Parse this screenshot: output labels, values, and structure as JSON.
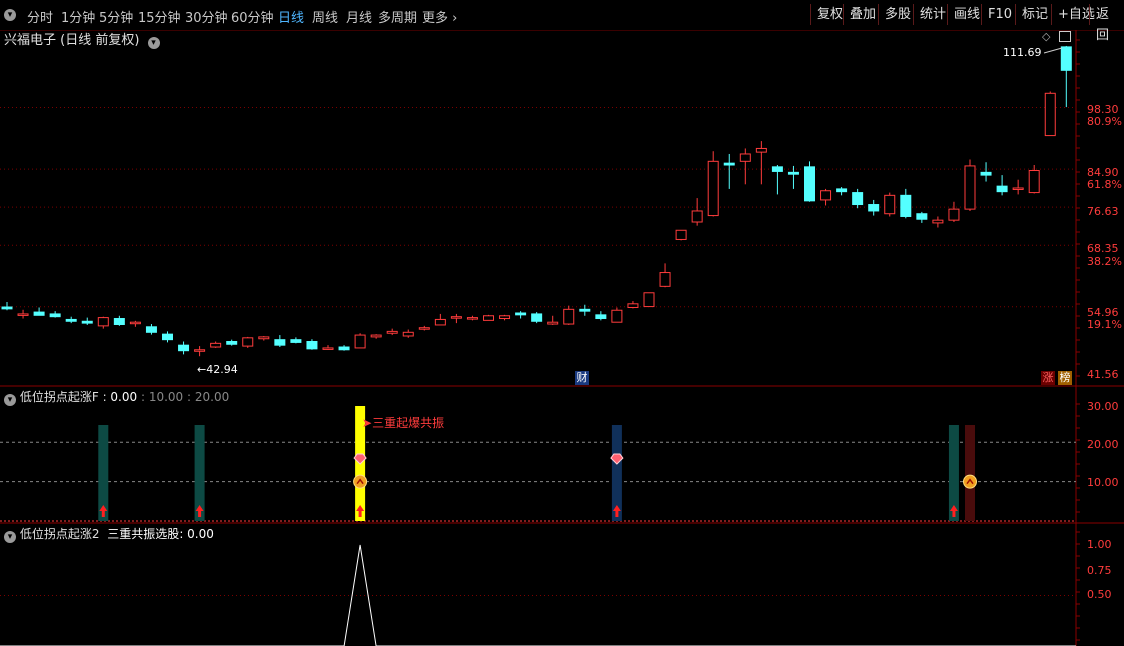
{
  "toolbar": {
    "periods": [
      "分时",
      "1分钟",
      "5分钟",
      "15分钟",
      "30分钟",
      "60分钟",
      "日线",
      "周线",
      "月线",
      "多周期",
      "更多"
    ],
    "active_period": "日线",
    "right_buttons": [
      "复权",
      "叠加",
      "多股",
      "统计",
      "画线",
      "F10",
      "标记",
      "+自选",
      "返回"
    ]
  },
  "main": {
    "title": "兴福电子 (日线 前复权)",
    "high_label": "111.69",
    "low_label": "42.94",
    "price_ticks": [
      "98.30",
      "84.90",
      "76.63",
      "68.35",
      "54.96",
      "41.56"
    ],
    "pct_ticks": [
      "80.9%",
      "61.8%",
      "38.2%",
      "19.1%"
    ],
    "badge_cai": "财",
    "badge_zhang": "涨",
    "badge_bang": "榜"
  },
  "ind1": {
    "title": "低位拐点起涨F",
    "value1": "0.00",
    "value2": "10.00",
    "value3": "20.00",
    "ticks": [
      "30.00",
      "20.00",
      "10.00"
    ],
    "annotation": "三重起爆共振",
    "colors": {
      "teal": "#0d4a44",
      "yellow": "#ffff00",
      "navy": "#10305a",
      "maroon": "#4a0c0c"
    }
  },
  "ind2": {
    "title": "低位拐点起涨2",
    "label": "三重共振选股",
    "value": "0.00",
    "ticks": [
      "1.00",
      "0.75",
      "0.50"
    ]
  },
  "colors": {
    "up": "#ff3c3c",
    "down": "#54ffff",
    "grid": "#7a0000"
  },
  "chart_data": {
    "type": "candlestick",
    "note_fields": [
      "open",
      "high",
      "low",
      "close"
    ],
    "candles": [
      [
        54.9,
        56.0,
        54.2,
        54.5
      ],
      [
        53.2,
        54.3,
        52.4,
        53.4
      ],
      [
        53.8,
        54.8,
        53.2,
        53.1
      ],
      [
        53.4,
        54.0,
        52.6,
        52.8
      ],
      [
        52.2,
        52.8,
        51.4,
        51.8
      ],
      [
        51.8,
        52.6,
        51.0,
        51.4
      ],
      [
        50.8,
        52.8,
        50.2,
        52.6
      ],
      [
        52.4,
        53.0,
        50.8,
        51.1
      ],
      [
        51.4,
        51.9,
        50.6,
        51.6
      ],
      [
        50.6,
        51.2,
        48.9,
        49.4
      ],
      [
        49.0,
        49.6,
        47.2,
        47.8
      ],
      [
        46.6,
        47.4,
        44.6,
        45.4
      ],
      [
        45.4,
        46.4,
        44.2,
        45.6
      ],
      [
        46.2,
        47.4,
        46.0,
        47.0
      ],
      [
        47.4,
        47.8,
        46.5,
        46.8
      ],
      [
        46.4,
        48.4,
        46.0,
        48.2
      ],
      [
        48.0,
        48.6,
        47.6,
        48.4
      ],
      [
        47.8,
        48.8,
        46.2,
        46.6
      ],
      [
        47.8,
        48.3,
        47.0,
        47.2
      ],
      [
        47.4,
        47.9,
        45.6,
        45.8
      ],
      [
        45.8,
        46.6,
        45.6,
        46.0
      ],
      [
        46.2,
        46.6,
        45.4,
        45.6
      ],
      [
        46.0,
        49.2,
        46.0,
        48.8
      ],
      [
        48.4,
        49.0,
        48.0,
        48.8
      ],
      [
        49.2,
        50.2,
        48.8,
        49.6
      ],
      [
        48.6,
        50.0,
        48.2,
        49.4
      ],
      [
        50.2,
        50.8,
        49.8,
        50.4
      ],
      [
        51.0,
        53.4,
        51.0,
        52.2
      ],
      [
        52.6,
        53.4,
        51.4,
        52.8
      ],
      [
        52.4,
        53.0,
        52.0,
        52.6
      ],
      [
        52.0,
        53.2,
        52.0,
        53.0
      ],
      [
        52.4,
        53.2,
        52.0,
        53.0
      ],
      [
        53.6,
        54.0,
        52.4,
        53.2
      ],
      [
        53.4,
        53.8,
        51.4,
        51.8
      ],
      [
        51.2,
        53.0,
        51.0,
        51.6
      ],
      [
        51.2,
        55.2,
        51.0,
        54.4
      ],
      [
        54.4,
        55.4,
        53.0,
        54.0
      ],
      [
        53.2,
        54.0,
        52.0,
        52.4
      ],
      [
        51.6,
        54.8,
        51.6,
        54.2
      ],
      [
        54.8,
        56.2,
        54.6,
        55.6
      ],
      [
        55.0,
        58.0,
        55.0,
        58.0
      ],
      [
        59.4,
        64.4,
        59.2,
        62.4
      ],
      [
        69.6,
        71.6,
        69.4,
        71.6
      ],
      [
        73.4,
        78.6,
        72.6,
        75.8
      ],
      [
        74.8,
        88.8,
        74.6,
        86.6
      ],
      [
        86.2,
        88.2,
        80.6,
        85.8
      ],
      [
        86.6,
        89.4,
        81.6,
        88.2
      ],
      [
        88.6,
        91.0,
        81.6,
        89.4
      ],
      [
        85.4,
        85.8,
        79.4,
        84.4
      ],
      [
        84.2,
        85.6,
        80.6,
        83.8
      ],
      [
        85.4,
        86.6,
        77.8,
        78.0
      ],
      [
        78.2,
        80.6,
        77.0,
        80.2
      ],
      [
        80.6,
        81.0,
        79.2,
        80.0
      ],
      [
        79.8,
        80.6,
        76.4,
        77.2
      ],
      [
        77.2,
        78.2,
        74.8,
        75.8
      ],
      [
        75.2,
        79.8,
        74.6,
        79.2
      ],
      [
        79.2,
        80.6,
        74.2,
        74.6
      ],
      [
        75.2,
        75.6,
        73.2,
        74.0
      ],
      [
        73.2,
        74.6,
        72.2,
        73.8
      ],
      [
        73.8,
        77.8,
        73.4,
        76.2
      ],
      [
        76.2,
        87.0,
        75.8,
        85.6
      ],
      [
        84.2,
        86.4,
        82.2,
        83.6
      ],
      [
        81.2,
        83.6,
        79.2,
        80.0
      ],
      [
        80.8,
        82.6,
        79.4,
        80.8
      ],
      [
        79.8,
        85.8,
        79.6,
        84.6
      ],
      [
        92.2,
        101.8,
        92.2,
        101.4
      ],
      [
        111.5,
        111.7,
        98.4,
        106.4
      ]
    ],
    "ind1_bars": [
      {
        "index": 6,
        "color": "teal",
        "arrow": true
      },
      {
        "index": 12,
        "color": "teal",
        "arrow": true
      },
      {
        "index": 22,
        "color": "yellow",
        "arrow": true,
        "gem": true,
        "coin": true,
        "full": true
      },
      {
        "index": 38,
        "color": "navy",
        "arrow": true,
        "gem": true
      },
      {
        "index": 59,
        "color": "teal",
        "arrow": true
      },
      {
        "index": 60,
        "color": "maroon",
        "coin": true
      }
    ],
    "ind2_spike_index": 22
  }
}
